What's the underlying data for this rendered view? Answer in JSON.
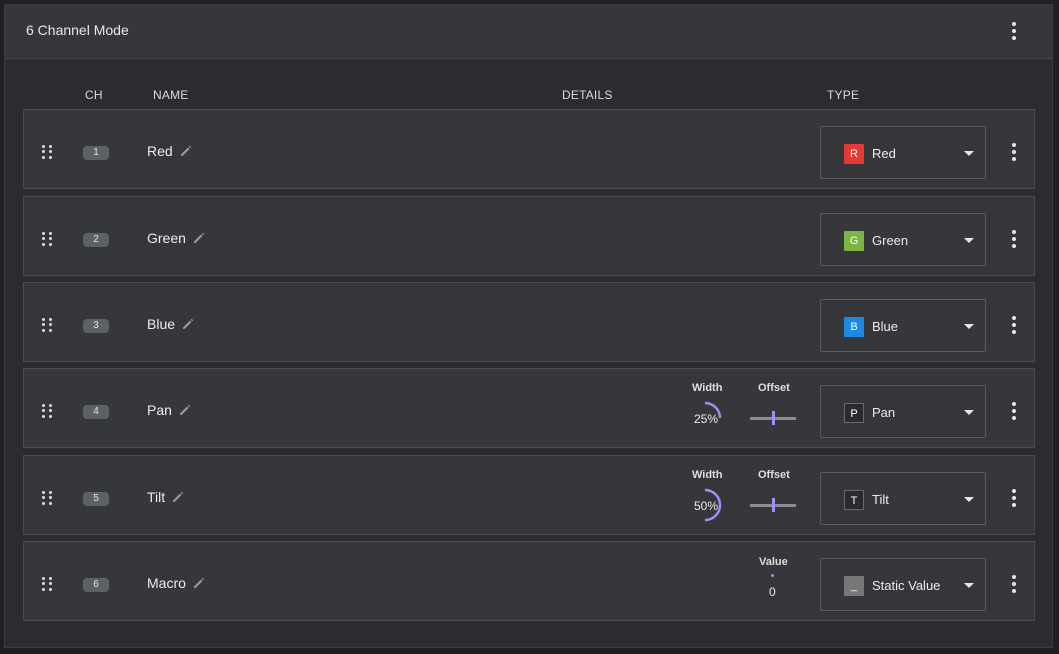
{
  "panel": {
    "title": "6 Channel Mode"
  },
  "columns": {
    "ch": "CH",
    "name": "NAME",
    "details": "DETAILS",
    "type": "TYPE"
  },
  "channels": [
    {
      "ch": "1",
      "name": "Red",
      "type": {
        "chip": "R",
        "label": "Red",
        "color": "#e53935"
      }
    },
    {
      "ch": "2",
      "name": "Green",
      "type": {
        "chip": "G",
        "label": "Green",
        "color": "#7cb342"
      }
    },
    {
      "ch": "3",
      "name": "Blue",
      "type": {
        "chip": "B",
        "label": "Blue",
        "color": "#1e88e5"
      }
    },
    {
      "ch": "4",
      "name": "Pan",
      "type": {
        "chip": "P",
        "label": "Pan",
        "color": "#2a2b2e"
      },
      "details": {
        "width_label": "Width",
        "width_value": "25%",
        "width_fraction": 0.25,
        "offset_label": "Offset",
        "offset_fraction": 0.5
      }
    },
    {
      "ch": "5",
      "name": "Tilt",
      "type": {
        "chip": "T",
        "label": "Tilt",
        "color": "#2a2b2e"
      },
      "details": {
        "width_label": "Width",
        "width_value": "50%",
        "width_fraction": 0.5,
        "offset_label": "Offset",
        "offset_fraction": 0.5
      }
    },
    {
      "ch": "6",
      "name": "Macro",
      "type": {
        "chip": "_",
        "label": "Static Value",
        "color": "#777777"
      },
      "details": {
        "value_label": "Value",
        "value": "0"
      }
    }
  ],
  "icons": {
    "drag": "drag-handle-icon",
    "edit": "pencil-icon",
    "menu": "more-vert-icon",
    "dropdown": "caret-down-icon"
  },
  "accent": "#a48cf5"
}
